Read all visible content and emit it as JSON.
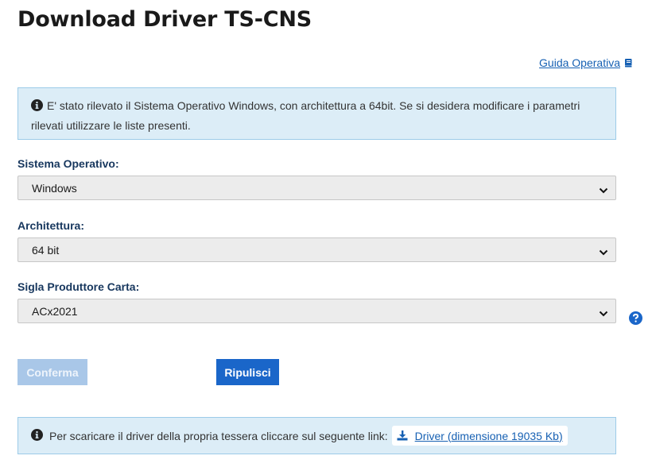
{
  "page": {
    "title": "Download Driver TS-CNS"
  },
  "guide": {
    "label": "Guida Operativa",
    "icon": "book-icon"
  },
  "alerts": {
    "detected": "E' stato rilevato il Sistema Operativo Windows, con architettura a 64bit. Se si desidera modificare i parametri rilevati utilizzare le liste presenti.",
    "download": "Per scaricare il driver della propria tessera cliccare sul seguente link:",
    "icon": "info-circle-icon"
  },
  "form": {
    "os": {
      "label": "Sistema Operativo:",
      "value": "Windows"
    },
    "arch": {
      "label": "Architettura:",
      "value": "64 bit"
    },
    "producer": {
      "label": "Sigla Produttore Carta:",
      "value": "ACx2021"
    }
  },
  "buttons": {
    "confirm": "Conferma",
    "reset": "Ripulisci"
  },
  "driver": {
    "label": "Driver (dimensione 19035 Kb)",
    "icon": "download-icon"
  },
  "colors": {
    "accent": "#1a66c9",
    "accent_disabled": "#a9c7e8",
    "label": "#17375e",
    "alert_bg": "#dcedf7",
    "alert_border": "#9ccbe8",
    "link": "#1660b3"
  }
}
